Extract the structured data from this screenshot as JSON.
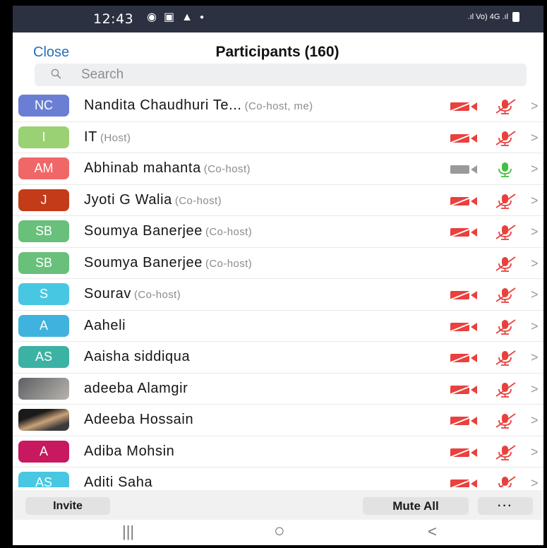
{
  "status_bar": {
    "time": "12:43",
    "left_icons": [
      "chrome-icon",
      "gallery-icon",
      "drive-icon",
      "dot-icon"
    ],
    "right_text": ".ıl Vo) 4G .ıl"
  },
  "header": {
    "close_label": "Close",
    "title": "Participants (160)"
  },
  "search": {
    "placeholder": "Search"
  },
  "participants": [
    {
      "initials": "NC",
      "color": "#6a7fd3",
      "name": "Nandita Chaudhuri Te...",
      "role": "(Co-host, me)",
      "camera": "off",
      "mic": "muted"
    },
    {
      "initials": "I",
      "color": "#9bd175",
      "name": "IT",
      "role": "(Host)",
      "camera": "off",
      "mic": "muted"
    },
    {
      "initials": "AM",
      "color": "#f06767",
      "name": "Abhinab mahanta",
      "role": "(Co-host)",
      "camera": "on",
      "mic": "on"
    },
    {
      "initials": "J",
      "color": "#c33b18",
      "name": "Jyoti G Walia",
      "role": "(Co-host)",
      "camera": "off",
      "mic": "muted"
    },
    {
      "initials": "SB",
      "color": "#68c07a",
      "name": "Soumya Banerjee",
      "role": "(Co-host)",
      "camera": "off",
      "mic": "muted"
    },
    {
      "initials": "SB",
      "color": "#68c07a",
      "name": "Soumya Banerjee",
      "role": "(Co-host)",
      "camera": "none",
      "mic": "muted"
    },
    {
      "initials": "S",
      "color": "#48c7e2",
      "name": "Sourav",
      "role": "(Co-host)",
      "camera": "off",
      "mic": "muted"
    },
    {
      "initials": "A",
      "color": "#3fb3de",
      "name": "Aaheli",
      "role": "",
      "camera": "off",
      "mic": "muted"
    },
    {
      "initials": "AS",
      "color": "#3cb2a5",
      "name": "Aaisha siddiqua",
      "role": "",
      "camera": "off",
      "mic": "muted"
    },
    {
      "initials": "",
      "color": "photo",
      "name": "adeeba Alamgir",
      "role": "",
      "camera": "off",
      "mic": "muted"
    },
    {
      "initials": "",
      "color": "photo2",
      "name": "Adeeba Hossain",
      "role": "",
      "camera": "off",
      "mic": "muted"
    },
    {
      "initials": "A",
      "color": "#c8185f",
      "name": "Adiba Mohsin",
      "role": "",
      "camera": "off",
      "mic": "muted"
    },
    {
      "initials": "AS",
      "color": "#48c7e2",
      "name": "Aditi Saha",
      "role": "",
      "camera": "off",
      "mic": "muted"
    }
  ],
  "footer": {
    "invite_label": "Invite",
    "mute_all_label": "Mute All",
    "more_label": "···"
  },
  "nav": {
    "recents": "|||",
    "home": "○",
    "back": "<"
  },
  "colors": {
    "muted_red": "#e8413e",
    "active_green": "#3fc13f",
    "camera_on_gray": "#9a9a9a",
    "close_blue": "#2a6fb3"
  }
}
